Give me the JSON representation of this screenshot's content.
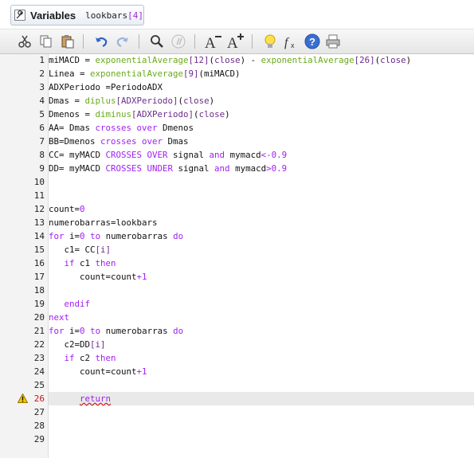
{
  "variables": {
    "label": "Variables",
    "code_name": "lookbars",
    "code_index": "[4]"
  },
  "toolbar": {
    "buttons": [
      "cut-icon",
      "copy-icon",
      "paste-icon",
      "undo-icon",
      "redo-icon",
      "search-icon",
      "comment-icon",
      "font-decrease-icon",
      "font-increase-icon",
      "lightbulb-icon",
      "function-icon",
      "help-icon",
      "print-icon"
    ],
    "font_minus_letter": "A",
    "font_plus_letter": "A"
  },
  "editor": {
    "current_line": 26,
    "warning_line": 26,
    "lines": [
      {
        "n": "1",
        "tokens": [
          [
            "t",
            "miMACD = "
          ],
          [
            "fn",
            "exponentialAverage"
          ],
          [
            "pr",
            "[12]"
          ],
          [
            "t",
            "("
          ],
          [
            "pr",
            "close"
          ],
          [
            "t",
            ") - "
          ],
          [
            "fn",
            "exponentialAverage"
          ],
          [
            "pr",
            "[26]"
          ],
          [
            "t",
            "("
          ],
          [
            "pr",
            "close"
          ],
          [
            "t",
            ")"
          ]
        ]
      },
      {
        "n": "2",
        "tokens": [
          [
            "t",
            "Linea = "
          ],
          [
            "fn",
            "exponentialAverage"
          ],
          [
            "pr",
            "[9]"
          ],
          [
            "t",
            "(miMACD)"
          ]
        ]
      },
      {
        "n": "3",
        "tokens": [
          [
            "t",
            "ADXPeriodo =PeriodoADX"
          ]
        ]
      },
      {
        "n": "4",
        "tokens": [
          [
            "t",
            "Dmas = "
          ],
          [
            "fn",
            "diplus"
          ],
          [
            "pr",
            "[ADXPeriodo]"
          ],
          [
            "t",
            "("
          ],
          [
            "pr",
            "close"
          ],
          [
            "t",
            ")"
          ]
        ]
      },
      {
        "n": "5",
        "tokens": [
          [
            "t",
            "Dmenos = "
          ],
          [
            "fn",
            "diminus"
          ],
          [
            "pr",
            "[ADXPeriodo]"
          ],
          [
            "t",
            "("
          ],
          [
            "pr",
            "close"
          ],
          [
            "t",
            ")"
          ]
        ]
      },
      {
        "n": "6",
        "tokens": [
          [
            "t",
            "AA= Dmas "
          ],
          [
            "kw",
            "crosses over"
          ],
          [
            "t",
            " Dmenos"
          ]
        ]
      },
      {
        "n": "7",
        "tokens": [
          [
            "t",
            "BB=Dmenos "
          ],
          [
            "kw",
            "crosses over"
          ],
          [
            "t",
            " Dmas"
          ]
        ]
      },
      {
        "n": "8",
        "tokens": [
          [
            "t",
            "CC= myMACD "
          ],
          [
            "kw",
            "CROSSES OVER"
          ],
          [
            "t",
            " signal "
          ],
          [
            "kw",
            "and"
          ],
          [
            "t",
            " mymacd"
          ],
          [
            "kw",
            "<-0.9"
          ]
        ]
      },
      {
        "n": "9",
        "tokens": [
          [
            "t",
            "DD= myMACD "
          ],
          [
            "kw",
            "CROSSES UNDER"
          ],
          [
            "t",
            " signal "
          ],
          [
            "kw",
            "and"
          ],
          [
            "t",
            " mymacd"
          ],
          [
            "kw",
            ">0.9"
          ]
        ]
      },
      {
        "n": "10",
        "tokens": []
      },
      {
        "n": "11",
        "tokens": []
      },
      {
        "n": "12",
        "tokens": [
          [
            "t",
            "count="
          ],
          [
            "num",
            "0"
          ]
        ]
      },
      {
        "n": "13",
        "tokens": [
          [
            "t",
            "numerobarras=lookbars"
          ]
        ]
      },
      {
        "n": "14",
        "tokens": [
          [
            "kw",
            "for"
          ],
          [
            "t",
            " i="
          ],
          [
            "num",
            "0"
          ],
          [
            "t",
            " "
          ],
          [
            "kw",
            "to"
          ],
          [
            "t",
            " numerobarras "
          ],
          [
            "kw",
            "do"
          ]
        ]
      },
      {
        "n": "15",
        "tokens": [
          [
            "t",
            "   c1= CC"
          ],
          [
            "pr",
            "[i]"
          ]
        ]
      },
      {
        "n": "16",
        "tokens": [
          [
            "t",
            "   "
          ],
          [
            "kw",
            "if"
          ],
          [
            "t",
            " c1 "
          ],
          [
            "kw",
            "then"
          ]
        ]
      },
      {
        "n": "17",
        "tokens": [
          [
            "t",
            "      count=count"
          ],
          [
            "kw",
            "+1"
          ]
        ]
      },
      {
        "n": "18",
        "tokens": []
      },
      {
        "n": "19",
        "tokens": [
          [
            "t",
            "   "
          ],
          [
            "kw",
            "endif"
          ]
        ]
      },
      {
        "n": "20",
        "tokens": [
          [
            "kw",
            "next"
          ]
        ]
      },
      {
        "n": "21",
        "tokens": [
          [
            "kw",
            "for"
          ],
          [
            "t",
            " i="
          ],
          [
            "num",
            "0"
          ],
          [
            "t",
            " "
          ],
          [
            "kw",
            "to"
          ],
          [
            "t",
            " numerobarras "
          ],
          [
            "kw",
            "do"
          ]
        ]
      },
      {
        "n": "22",
        "tokens": [
          [
            "t",
            "   c2=DD"
          ],
          [
            "pr",
            "[i]"
          ]
        ]
      },
      {
        "n": "23",
        "tokens": [
          [
            "t",
            "   "
          ],
          [
            "kw",
            "if"
          ],
          [
            "t",
            " c2 "
          ],
          [
            "kw",
            "then"
          ]
        ]
      },
      {
        "n": "24",
        "tokens": [
          [
            "t",
            "      count=count"
          ],
          [
            "kw",
            "+1"
          ]
        ]
      },
      {
        "n": "25",
        "tokens": []
      },
      {
        "n": "26",
        "tokens": [
          [
            "t",
            "      "
          ],
          [
            "ret",
            "return"
          ]
        ]
      },
      {
        "n": "27",
        "tokens": []
      },
      {
        "n": "28",
        "tokens": []
      },
      {
        "n": "29",
        "tokens": []
      }
    ]
  }
}
